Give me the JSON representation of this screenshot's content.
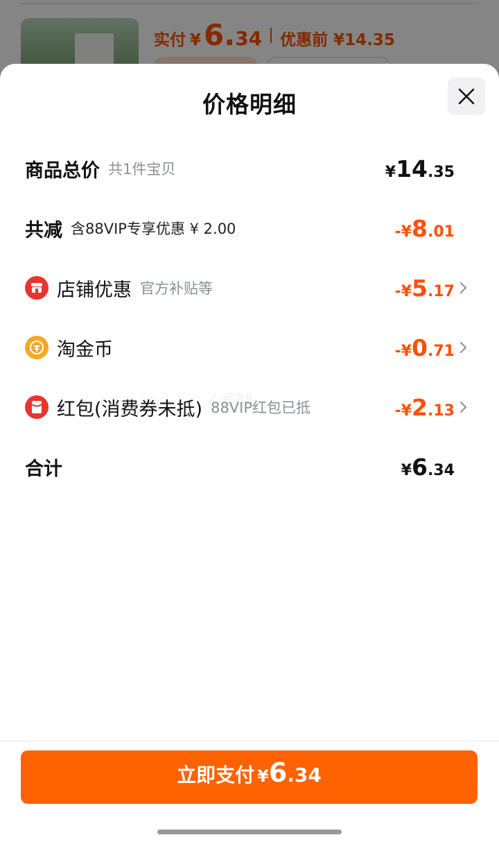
{
  "background": {
    "pay_label": "实付",
    "pay_yen": "¥",
    "pay_int": "6.",
    "pay_dec": "34",
    "before_label": "优惠前 ¥14.35"
  },
  "sheet": {
    "title": "价格明细",
    "close_icon": "close-icon"
  },
  "rows": [
    {
      "label": "商品总价",
      "sub": "共1件宝贝",
      "amount_prefix": "¥",
      "amount_int": "14",
      "amount_dec": ".35",
      "color": "black"
    },
    {
      "label": "共减",
      "sub": "含88VIP专享优惠 ¥ 2.00",
      "amount_prefix": "-¥",
      "amount_int": "8",
      "amount_dec": ".01",
      "color": "orange"
    },
    {
      "label": "店铺优惠",
      "sub": "官方补贴等",
      "amount_prefix": "-¥",
      "amount_int": "5",
      "amount_dec": ".17",
      "icon": "store-icon",
      "icon_color": "#e8342f",
      "chevron": true
    },
    {
      "label": "淘金币",
      "sub": "",
      "amount_prefix": "-¥",
      "amount_int": "0",
      "amount_dec": ".71",
      "icon": "coin-icon",
      "icon_color": "#f7a823",
      "chevron": true
    },
    {
      "label": "红包(消费券未抵)",
      "sub": "88VIP红包已抵",
      "amount_prefix": "-¥",
      "amount_int": "2",
      "amount_dec": ".13",
      "icon": "red-packet-icon",
      "icon_color": "#e8342f",
      "chevron": true
    },
    {
      "label": "合计",
      "sub": "",
      "amount_prefix": "¥",
      "amount_int": "6",
      "amount_dec": ".34",
      "color": "black"
    }
  ],
  "pay_button": {
    "label": "立即支付",
    "yen": "¥",
    "int": "6",
    "dec": ".34"
  },
  "watermark": "心鄙88",
  "colors": {
    "accent": "#ff5000",
    "button": "#ff6200"
  }
}
